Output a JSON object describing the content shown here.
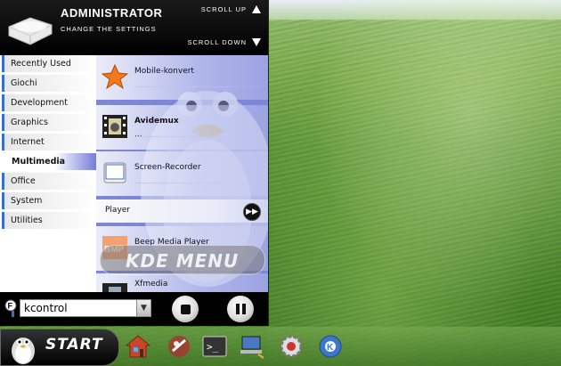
{
  "header": {
    "title": "ADMINISTRATOR",
    "subtitle": "CHANGE THE SETTINGS",
    "scroll_up": "SCROLL UP",
    "scroll_down": "SCROLL DOWN"
  },
  "categories": [
    {
      "label": "Recently Used"
    },
    {
      "label": "Giochi"
    },
    {
      "label": "Development"
    },
    {
      "label": "Graphics"
    },
    {
      "label": "Internet"
    },
    {
      "label": "Multimedia"
    },
    {
      "label": "Office"
    },
    {
      "label": "System"
    },
    {
      "label": "Utilities"
    }
  ],
  "active_category": "Multimedia",
  "apps": [
    {
      "name": "Mobile-konvert",
      "desc": "",
      "icon": "star-icon"
    },
    {
      "name": "Avidemux",
      "desc": "...",
      "icon": "film-icon"
    },
    {
      "name": "Screen-Recorder",
      "desc": "",
      "icon": "recorder-icon"
    }
  ],
  "player": {
    "label": "Player"
  },
  "lower_apps": [
    {
      "name": "Beep Media Player",
      "icon": "bmp-icon"
    },
    {
      "name": "Xfmedia",
      "icon": "film-icon"
    }
  ],
  "overlay_text": "KDE MENU",
  "search": {
    "value": "kcontrol"
  },
  "start_label": "START",
  "taskbar_icons": [
    "home-icon",
    "graphics-icon",
    "terminal-icon",
    "network-icon",
    "settings-icon",
    "kde-logo-icon"
  ],
  "colors": {
    "accent": "#7e86d8",
    "category_marker": "#3b6fc9"
  }
}
